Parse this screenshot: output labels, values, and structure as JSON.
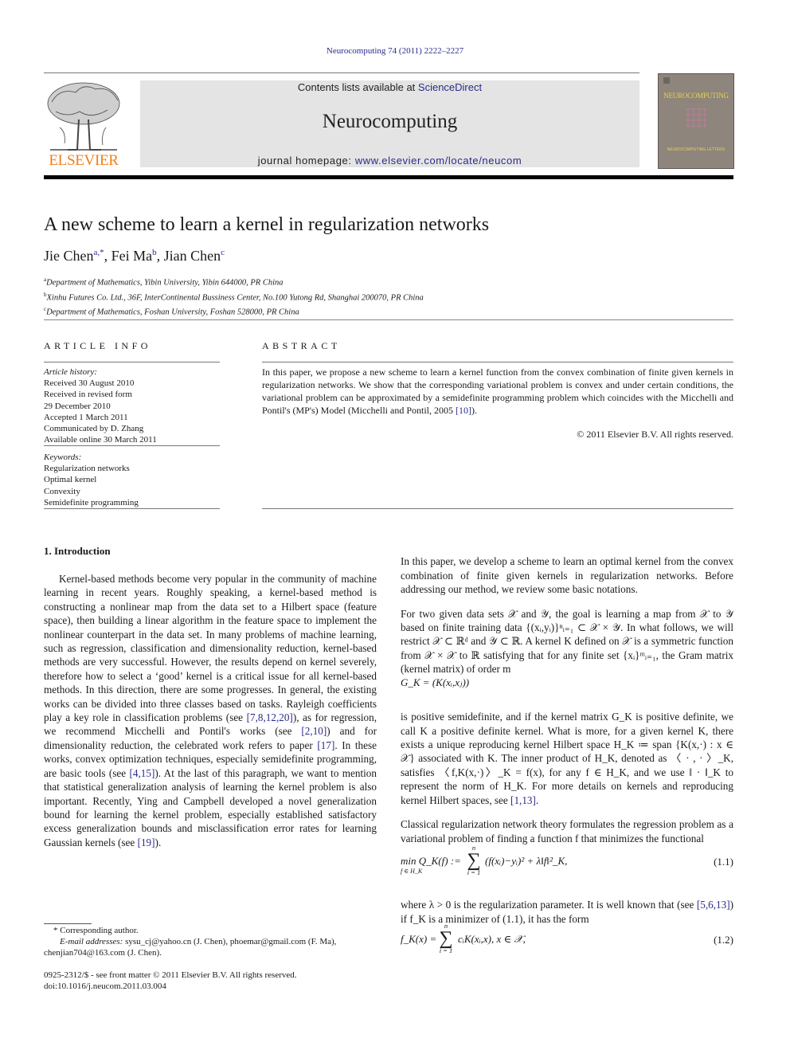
{
  "header": {
    "citation": "Neurocomputing 74 (2011) 2222–2227",
    "publisher_logo_text": "ELSEVIER",
    "contents_prefix": "Contents lists available at ",
    "contents_link": "ScienceDirect",
    "journal_name": "Neurocomputing",
    "homepage_prefix": "journal homepage: ",
    "homepage_link": "www.elsevier.com/locate/neucom",
    "cover_title": "NEUROCOMPUTING",
    "cover_subtitle": "NEUROCOMPUTING LETTERS",
    "colors": {
      "link": "#2b2b8c",
      "elsevier_orange": "#f07f1a",
      "header_box": "#e4e4e4",
      "cover_bg": "#8e857c",
      "cover_text": "#e8d34a"
    }
  },
  "article": {
    "title": "A new scheme to learn a kernel in regularization networks",
    "authors": [
      {
        "name": "Jie Chen",
        "sup": "a,*"
      },
      {
        "name": "Fei Ma",
        "sup": "b"
      },
      {
        "name": "Jian Chen",
        "sup": "c"
      }
    ],
    "affiliations": [
      {
        "label": "a",
        "text": "Department of Mathematics, Yibin University, Yibin 644000, PR China"
      },
      {
        "label": "b",
        "text": "Xinhu Futures Co. Ltd., 36F, InterContinental Bussiness Center, No.100 Yutong Rd, Shanghai 200070, PR China"
      },
      {
        "label": "c",
        "text": "Department of Mathematics, Foshan University, Foshan 528000, PR China"
      }
    ]
  },
  "article_info": {
    "heading": "ARTICLE INFO",
    "history_label": "Article history:",
    "history": [
      "Received 30 August 2010",
      "Received in revised form",
      "29 December 2010",
      "Accepted 1 March 2011",
      "Communicated by D. Zhang",
      "Available online 30 March 2011"
    ],
    "keywords_label": "Keywords:",
    "keywords": [
      "Regularization networks",
      "Optimal kernel",
      "Convexity",
      "Semidefinite programming"
    ]
  },
  "abstract": {
    "heading": "ABSTRACT",
    "text": "In this paper, we propose a new scheme to learn a kernel function from the convex combination of finite given kernels in regularization networks. We show that the corresponding variational problem is convex and under certain conditions, the variational problem can be approximated by a semidefinite programming problem which coincides with the Micchelli and Pontil's (MP's) Model (Micchelli and Pontil, 2005 ",
    "ref": "[10]",
    "text_end": ").",
    "copyright": "© 2011 Elsevier B.V. All rights reserved."
  },
  "intro": {
    "heading": "1.  Introduction",
    "p1_a": "Kernel-based methods become very popular in the community of machine learning in recent years. Roughly speaking, a kernel-based method is constructing a nonlinear map from the data set to a Hilbert space (feature space), then building a linear algorithm in the feature space to implement the nonlinear counterpart in the data set. In many problems of machine learning, such as regression, classification and dimensionality reduction, kernel-based methods are very successful. However, the results depend on kernel severely, therefore how to select a ‘good’ kernel is a critical issue for all kernel-based methods. In this direction, there are some progresses. In general, the existing works can be divided into three classes based on tasks. Rayleigh coefficients play a key role in classification problems (see ",
    "ref1": "[7,8,12,20]",
    "p1_b": "), as for regression, we recommend Micchelli and Pontil's works (see ",
    "ref2": "[2,10]",
    "p1_c": ") and for dimensionality reduction, the celebrated work refers to paper ",
    "ref3": "[17]",
    "p1_d": ". In these works, convex optimization techniques, especially semidefinite programming, are basic tools (see ",
    "ref4": "[4,15]",
    "p1_e": "). At the last of this paragraph, we want to mention that statistical generalization analysis of learning the kernel problem is also important. Recently, Ying and Campbell developed a novel generalization bound for learning the kernel problem, especially established satisfactory excess generalization bounds and misclassification error rates for learning Gaussian kernels (see ",
    "ref5": "[19]",
    "p1_f": ").",
    "r_p1": "In this paper, we develop a scheme to learn an optimal kernel from the convex combination of finite given kernels in regularization networks. Before addressing our method, we review some basic notations.",
    "r_p2": "For two given data sets 𝒳 and 𝒴, the goal is learning a map from 𝒳 to 𝒴 based on finite training data {(xᵢ,yᵢ)}ⁿᵢ₌₁ ⊂ 𝒳 × 𝒴. In what follows, we will restrict 𝒳 ⊂ ℝᵈ and 𝒴 ⊂ ℝ. A kernel K defined on 𝒳 is a symmetric function from 𝒳 × 𝒳 to ℝ satisfying that for any finite set {xᵢ}ᵐᵢ₌₁, the Gram matrix (kernel matrix) of order m",
    "eq_gk": "G_K = (K(xᵢ,xⱼ))",
    "r_p3_a": "is positive semidefinite, and if the kernel matrix G_K is positive definite, we call K a positive definite kernel. What is more, for a given kernel K, there exists a unique reproducing kernel Hilbert space H_K ≔ span {K(x,·) : x ∈ 𝒳} associated with K. The inner product of H_K, denoted as 〈 · , · 〉_K, satisfies 〈f,K(x,·)〉_K = f(x), for any f ∈ H_K, and we use ‖ · ‖_K to represent the norm of H_K. For more details on kernels and reproducing kernel Hilbert spaces, see ",
    "r_ref1": "[1,13]",
    "r_p3_b": ".",
    "r_p4": "Classical regularization network theory formulates the regression problem as a variational problem of finding a function f that minimizes the functional",
    "eq11_lhs": "min Q_K(f) :=",
    "eq11_sub": "f ∈ H_K",
    "eq11_rhs": "(f(xᵢ)−yᵢ)² + λ‖f‖²_K,",
    "eq11_sum_top": "n",
    "eq11_sum_bot": "i = 1",
    "eq11_num": "(1.1)",
    "r_p5_a": "where λ > 0 is the regularization parameter. It is well known that (see ",
    "r_ref2": "[5,6,13]",
    "r_p5_b": ") if f_K is a minimizer of (1.1), it has the form",
    "eq12_lhs": "f_K(x) =",
    "eq12_rhs": "cᵢK(xᵢ,x),    x ∈ 𝒳,",
    "eq12_sum_top": "n",
    "eq12_sum_bot": "i = 1",
    "eq12_num": "(1.2)"
  },
  "footnotes": {
    "corresponding": "* Corresponding author.",
    "email_label": "E-mail addresses:",
    "emails": " sysu_cj@yahoo.cn (J. Chen), phoemar@gmail.com (F. Ma), chenjian704@163.com (J. Chen).",
    "issn": "0925-2312/$ - see front matter © 2011 Elsevier B.V. All rights reserved.",
    "doi": "doi:10.1016/j.neucom.2011.03.004"
  }
}
